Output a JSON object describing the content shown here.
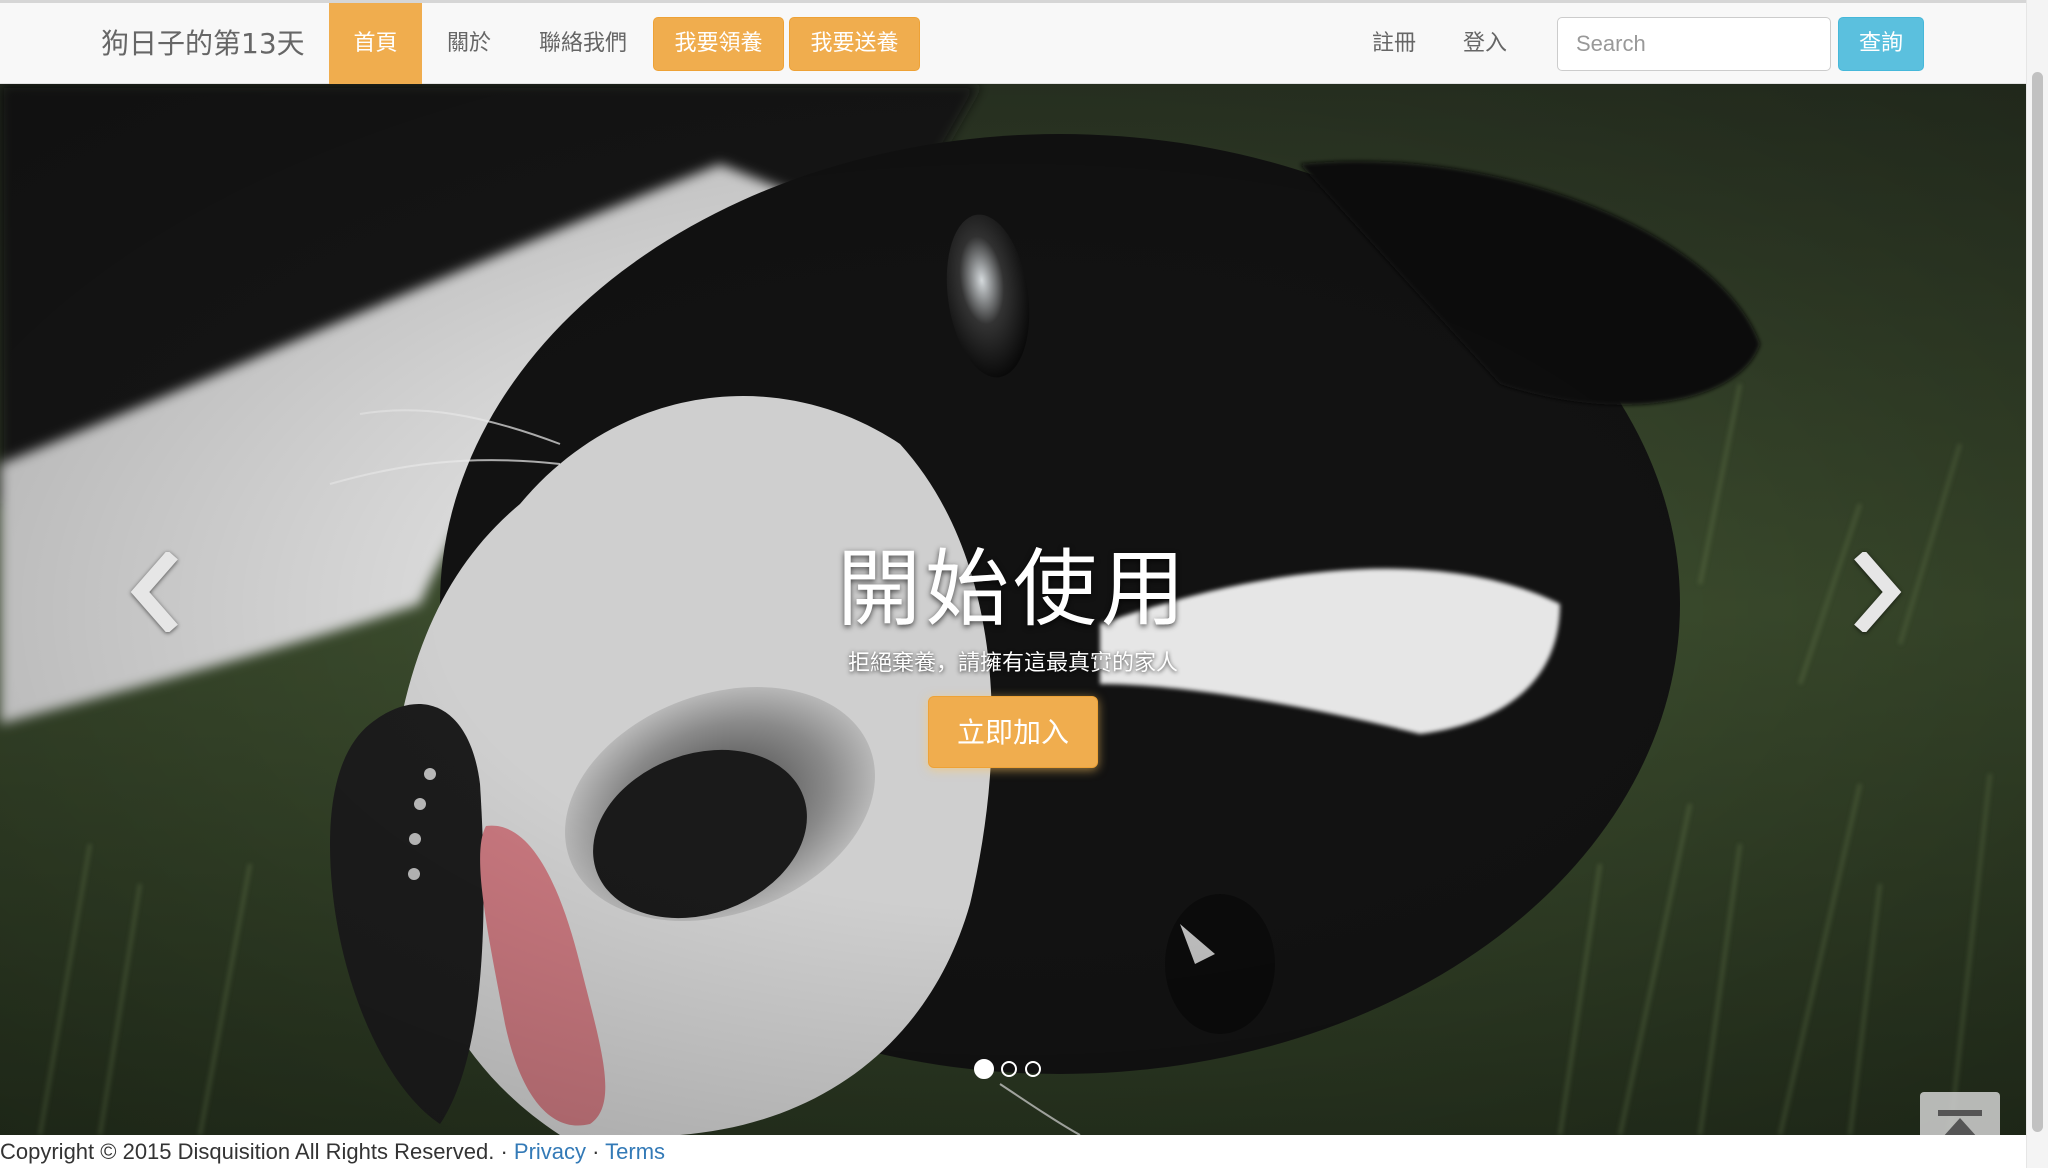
{
  "navbar": {
    "brand": "狗日子的第13天",
    "links": [
      {
        "label": "首頁",
        "active": true
      },
      {
        "label": "關於"
      },
      {
        "label": "聯絡我們"
      }
    ],
    "buttons": [
      {
        "label": "我要領養"
      },
      {
        "label": "我要送養"
      }
    ],
    "right_links": [
      {
        "label": "註冊"
      },
      {
        "label": "登入"
      }
    ],
    "search": {
      "placeholder": "Search",
      "value": "",
      "button_label": "查詢"
    }
  },
  "carousel": {
    "heading": "開始使用",
    "subheading": "拒絕棄養，請擁有這最真實的家人",
    "cta_label": "立即加入",
    "slide_count": 3,
    "active_index": 0,
    "prev_icon": "chevron-left-icon",
    "next_icon": "chevron-right-icon"
  },
  "back_to_top": {
    "icon": "arrow-up-to-top-icon"
  },
  "footer": {
    "copyright": "Copyright © 2015 Disquisition All Rights Reserved. · ",
    "privacy_label": "Privacy",
    "separator": " · ",
    "terms_label": "Terms"
  },
  "colors": {
    "accent": "#f0ad4e",
    "info": "#5bc0de",
    "link": "#337ab7",
    "navbar_bg": "#f8f8f8"
  }
}
